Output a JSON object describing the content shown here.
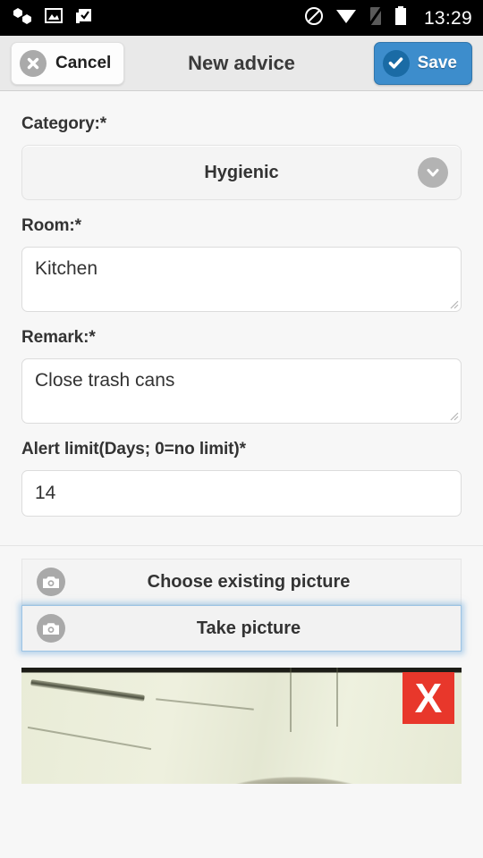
{
  "status_bar": {
    "time": "13:29",
    "left_icons": [
      {
        "name": "app-hexagons-icon"
      },
      {
        "name": "image-icon"
      },
      {
        "name": "clipboard-check-icon"
      }
    ],
    "right_icons": [
      {
        "name": "do-not-disturb-icon"
      },
      {
        "name": "wifi-icon"
      },
      {
        "name": "signal-off-icon"
      },
      {
        "name": "battery-icon"
      }
    ]
  },
  "action_bar": {
    "cancel_label": "Cancel",
    "title": "New advice",
    "save_label": "Save",
    "save_color": "#3d8dcc"
  },
  "form": {
    "category": {
      "label": "Category:*",
      "value": "Hygienic"
    },
    "room": {
      "label": "Room:*",
      "value": "Kitchen"
    },
    "remark": {
      "label": "Remark:*",
      "value": "Close trash cans"
    },
    "alert_limit": {
      "label": "Alert limit(Days; 0=no limit)*",
      "value": "14"
    }
  },
  "picture_actions": {
    "choose_label": "Choose existing picture",
    "take_label": "Take picture"
  },
  "photo": {
    "delete_label": "X",
    "delete_color": "#e8372b"
  }
}
